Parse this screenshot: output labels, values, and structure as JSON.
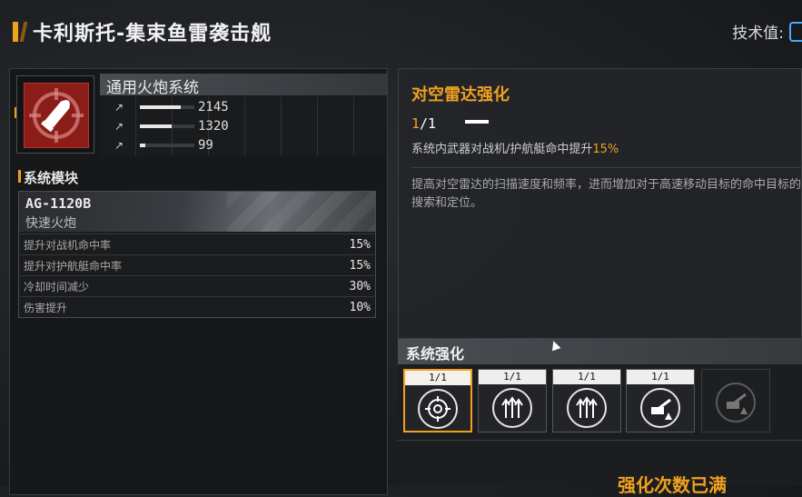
{
  "header": {
    "title": "卡利斯托-集束鱼雷袭击舰",
    "tech_label": "技术值:"
  },
  "weapon": {
    "system_name": "通用火炮系统",
    "stats": [
      {
        "icon": "damage-icon",
        "value": "2145",
        "fill": 0.75
      },
      {
        "icon": "range-icon",
        "value": "1320",
        "fill": 0.58
      },
      {
        "icon": "rate-icon",
        "value": "99",
        "fill": 0.1
      }
    ]
  },
  "module_section": {
    "title": "系统模块",
    "code": "AG-1120B",
    "name": "快速火炮",
    "rows": [
      {
        "label": "提升对战机命中率",
        "value": "15%"
      },
      {
        "label": "提升对护航艇命中率",
        "value": "15%"
      },
      {
        "label": "冷却时间减少",
        "value": "30%"
      },
      {
        "label": "伤害提升",
        "value": "10%"
      }
    ]
  },
  "detail": {
    "title": "对空雷达强化",
    "level_current": "1",
    "level_max": "/1",
    "effect_prefix": "系统内武器对战机/护航艇命中提升",
    "effect_value": "15%",
    "description": "提高对空雷达的扫描速度和频率，进而增加对于高速移动目标的命中目标的搜索和定位。"
  },
  "upgrades": {
    "title": "系统强化",
    "slots": [
      {
        "level": "1/1",
        "icon": "radar-target-icon",
        "selected": true
      },
      {
        "level": "1/1",
        "icon": "triple-arrow-up-icon",
        "selected": false
      },
      {
        "level": "1/1",
        "icon": "triple-arrow-up-icon",
        "selected": false
      },
      {
        "level": "1/1",
        "icon": "turret-upgrade-icon",
        "selected": false
      },
      {
        "level": "",
        "icon": "turret-upgrade-locked-icon",
        "selected": false
      }
    ],
    "status": "强化次数已满"
  },
  "colors": {
    "accent": "#f0a020",
    "weapon_bg": "#8a1d18"
  }
}
